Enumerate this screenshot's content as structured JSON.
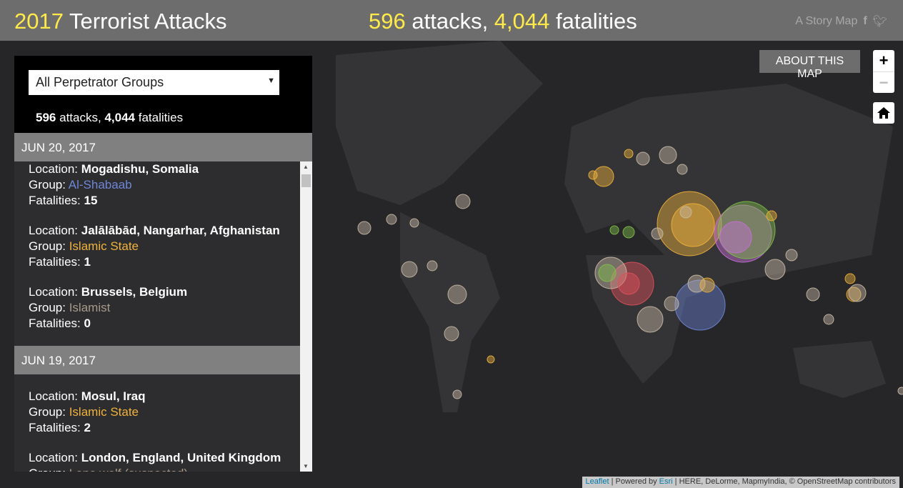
{
  "header": {
    "year": "2017",
    "title": "Terrorist Attacks",
    "attacks": "596",
    "attacks_label": "attacks,",
    "fatalities": "4,044",
    "fatalities_label": "fatalities",
    "story_map": "A Story Map",
    "social": [
      "facebook-icon",
      "twitter-icon"
    ]
  },
  "panel": {
    "filter": "All Perpetrator Groups",
    "attacks": "596",
    "attacks_label": "attacks,",
    "fatalities": "4,044",
    "fatalities_label": "fatalities"
  },
  "labels": {
    "location": "Location: ",
    "group": "Group: ",
    "fatalities": "Fatalities: "
  },
  "days": [
    {
      "date": "JUN 20, 2017",
      "events": [
        {
          "location": "Mogadishu, Somalia",
          "group": "Al-Shabaab",
          "group_color": "#6f86d6",
          "fatalities": "15"
        },
        {
          "location": "Jalālābād, Nangarhar, Afghanistan",
          "group": "Islamic State",
          "group_color": "#f0b23c",
          "fatalities": "1"
        },
        {
          "location": "Brussels, Belgium",
          "group": "Islamist",
          "group_color": "#a8998a",
          "fatalities": "0"
        }
      ]
    },
    {
      "date": "JUN 19, 2017",
      "events": [
        {
          "location": "Mosul, Iraq",
          "group": "Islamic State",
          "group_color": "#f0b23c",
          "fatalities": "2"
        },
        {
          "location": "London, England, United Kingdom",
          "group": "Lone wolf (suspected)",
          "group_color": "#a8998a",
          "fatalities": ""
        }
      ]
    }
  ],
  "map": {
    "about": "ABOUT THIS MAP",
    "zoom_in": "+",
    "zoom_out": "−",
    "group_colors": {
      "islamic_state": "#f0b23c",
      "al_shabaab": "#6f86d6",
      "boko_haram": "#e0505a",
      "taliban": "#c86ed8",
      "aqim": "#7fbf4a",
      "other": "#c8b8a6"
    }
  },
  "attribution": {
    "leaflet": "Leaflet",
    "powered": " | Powered by ",
    "esri": "Esri",
    "rest": " | HERE, DeLorme, MapmyIndia, © OpenStreetMap contributors"
  }
}
